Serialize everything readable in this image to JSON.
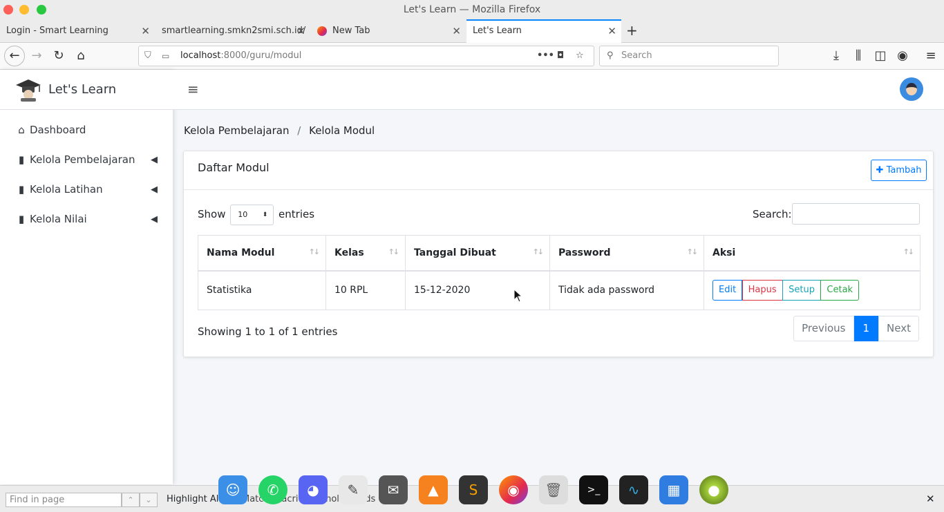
{
  "window": {
    "title": "Let's Learn — Mozilla Firefox"
  },
  "tabs": [
    {
      "label": "Login - Smart Learning"
    },
    {
      "label": "smartlearning.smkn2smi.sch.id/"
    },
    {
      "label": "New Tab"
    },
    {
      "label": "Let's Learn"
    }
  ],
  "url": {
    "host": "localhost",
    "path": ":8000/guru/modul"
  },
  "search_bar": {
    "placeholder": "Search"
  },
  "brand": {
    "title": "Let's Learn"
  },
  "sidebar": {
    "items": [
      {
        "label": "Dashboard",
        "icon": "home-icon"
      },
      {
        "label": "Kelola Pembelajaran",
        "icon": "book-icon"
      },
      {
        "label": "Kelola Latihan",
        "icon": "book-icon"
      },
      {
        "label": "Kelola Nilai",
        "icon": "book-icon"
      }
    ]
  },
  "breadcrumb": {
    "parent": "Kelola Pembelajaran",
    "sep": "/",
    "current": "Kelola Modul"
  },
  "card": {
    "title": "Daftar Modul",
    "add_label": "Tambah"
  },
  "table_controls": {
    "show": "Show",
    "entries_value": "10",
    "entries": "entries",
    "search_label": "Search:"
  },
  "table": {
    "columns": [
      "Nama Modul",
      "Kelas",
      "Tanggal Dibuat",
      "Password",
      "Aksi"
    ],
    "rows": [
      {
        "nama": "Statistika",
        "kelas": "10 RPL",
        "tanggal": "15-12-2020",
        "password": "Tidak ada password"
      }
    ],
    "actions": [
      "Edit",
      "Hapus",
      "Setup",
      "Cetak"
    ]
  },
  "pagination": {
    "info": "Showing 1 to 1 of 1 entries",
    "previous": "Previous",
    "current": "1",
    "next": "Next"
  },
  "findbar": {
    "placeholder": "Find in page",
    "highlight": "Highlight All",
    "obscured_text": "Match Diacritics  Whole Words"
  },
  "colors": {
    "primary": "#007bff",
    "danger": "#dc3545",
    "info": "#17a2b8",
    "success": "#28a745"
  }
}
